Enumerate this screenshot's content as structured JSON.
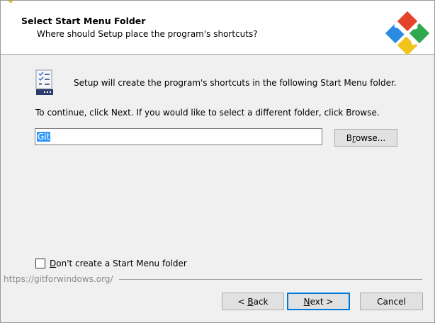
{
  "header": {
    "title": "Select Start Menu Folder",
    "subtitle": "Where should Setup place the program's shortcuts?"
  },
  "content": {
    "info": "Setup will create the program's shortcuts in the following Start Menu folder.",
    "instruction": "To continue, click Next. If you would like to select a different folder, click Browse.",
    "folder_value": "Git",
    "browse_label_before": "B",
    "browse_label_mnemonic": "r",
    "browse_label_after": "owse...",
    "checkbox_mnemonic": "D",
    "checkbox_label_after": "on't create a Start Menu folder",
    "checkbox_checked": false
  },
  "footer": {
    "url": "https://gitforwindows.org/",
    "back_prefix": "< ",
    "back_mnemonic": "B",
    "back_after": "ack",
    "next_mnemonic": "N",
    "next_after": "ext >",
    "cancel_label": "Cancel"
  },
  "colors": {
    "selection": "#3399ff",
    "default_button_border": "#0078d7"
  }
}
